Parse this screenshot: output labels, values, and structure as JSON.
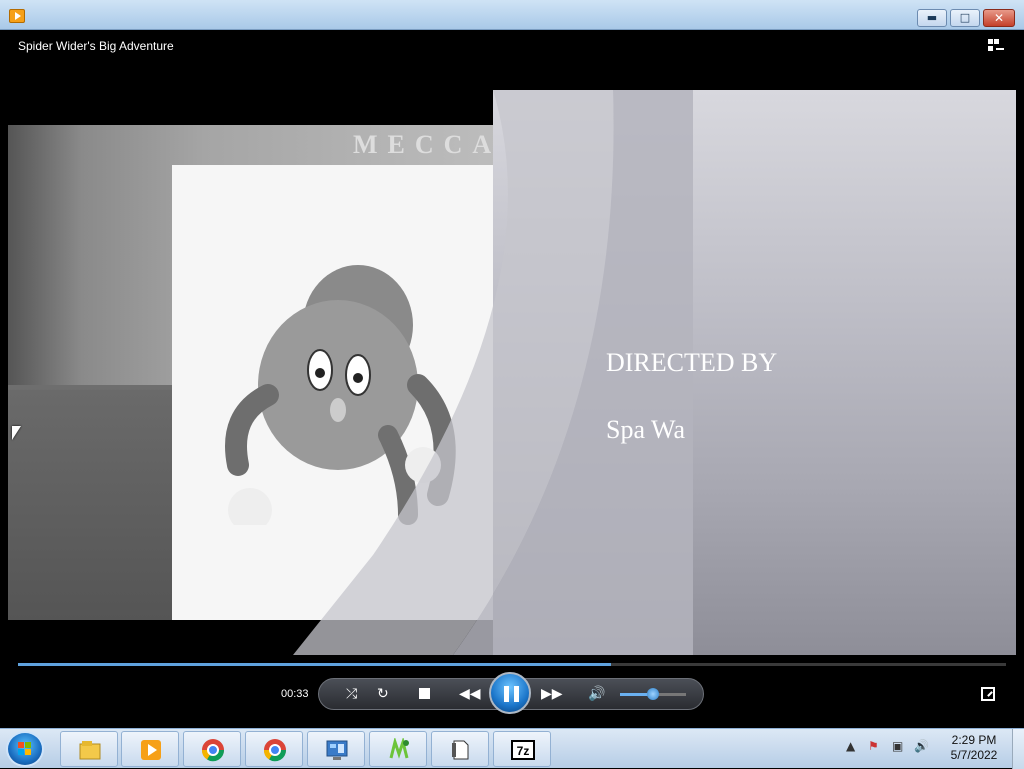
{
  "window": {
    "title": "",
    "icon": "media-player-icon",
    "buttons": {
      "minimize": "minimize-icon",
      "maximize": "maximize-icon",
      "close": "close-icon"
    }
  },
  "player": {
    "movie_title": "Spider Wider's Big Adventure",
    "layout_icon": "switch-to-library-icon"
  },
  "video": {
    "sign_text": "MECCA",
    "credit_label": "DIRECTED BY",
    "credit_name": "Spa Wa"
  },
  "playback": {
    "elapsed": "00:33",
    "seek_progress": 0.6,
    "volume": 0.5,
    "state": "playing"
  },
  "controls": {
    "shuffle": "shuffle-icon",
    "repeat": "repeat-icon",
    "stop": "stop-icon",
    "previous": "previous-icon",
    "play_pause": "pause-icon",
    "next": "next-icon",
    "mute": "speaker-icon",
    "fullscreen": "fullscreen-icon"
  },
  "taskbar": {
    "items": [
      "windows-explorer-icon",
      "media-player-icon",
      "chrome-icon",
      "chrome-icon",
      "control-panel-icon",
      "notepad-plus-icon",
      "file-icon",
      "7zip-icon"
    ],
    "tray": [
      "show-hidden-icons",
      "flag-icon",
      "network-icon",
      "volume-icon"
    ],
    "time": "2:29 PM",
    "date": "5/7/2022"
  },
  "colors": {
    "accent": "#5fa2de",
    "play_button": "#1b75c9",
    "taskbar": "#c9daee"
  }
}
